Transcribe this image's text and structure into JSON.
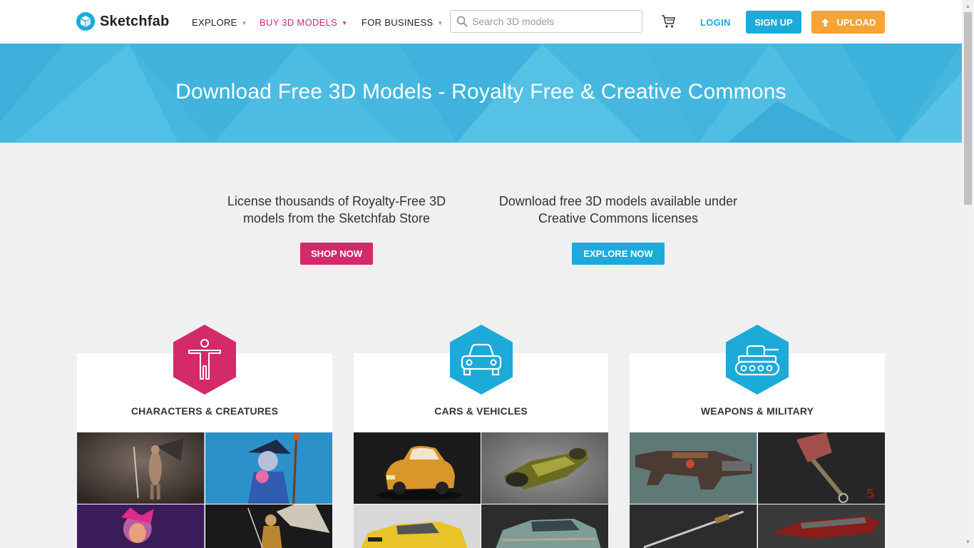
{
  "header": {
    "logo_text": "Sketchfab",
    "nav": {
      "explore": "EXPLORE",
      "buy": "BUY 3D MODELS",
      "business": "FOR BUSINESS"
    },
    "search_placeholder": "Search 3D models",
    "login": "LOGIN",
    "signup": "SIGN UP",
    "upload": "UPLOAD"
  },
  "banner": {
    "title": "Download Free 3D Models - Royalty Free & Creative Commons"
  },
  "promo": {
    "store_text": "License thousands of Royalty-Free 3D models from the Sketchfab Store",
    "store_button": "SHOP NOW",
    "free_text": "Download free 3D models available under Creative Commons licenses",
    "free_button": "EXPLORE NOW"
  },
  "categories": [
    {
      "title": "CHARACTERS & CREATURES",
      "icon": "person-icon",
      "color": "#d32a69"
    },
    {
      "title": "CARS & VEHICLES",
      "icon": "car-icon",
      "color": "#1caad9"
    },
    {
      "title": "WEAPONS & MILITARY",
      "icon": "tank-icon",
      "color": "#1caad9"
    }
  ],
  "colors": {
    "brand_blue": "#1caad9",
    "brand_pink": "#d32a69",
    "upload_orange": "#f7a336",
    "banner_blue": "#46b8e0"
  }
}
